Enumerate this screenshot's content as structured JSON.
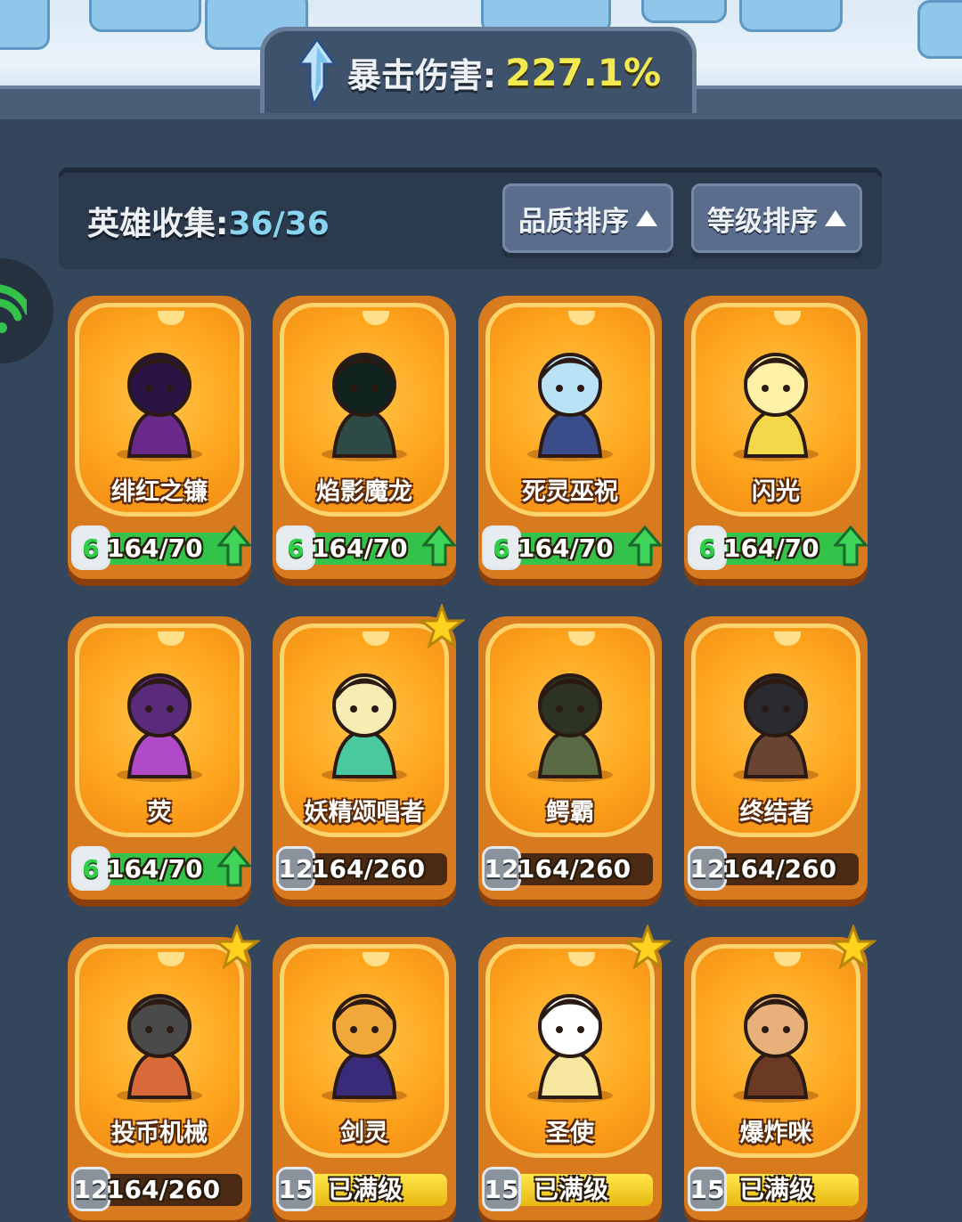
{
  "crit": {
    "label": "暴击伤害:",
    "value": "227.1%"
  },
  "collection": {
    "label": "英雄收集:",
    "count": "36/36"
  },
  "sort": {
    "quality": "品质排序",
    "level": "等级排序"
  },
  "colors": {
    "accent_gold": "#f3ea52",
    "progress_green": "#33c24a",
    "card_orange": "#ffa61e"
  },
  "heroes": [
    {
      "name": "绯红之镰",
      "level": "6",
      "progress": "164/70",
      "upgradable": true,
      "starred": false
    },
    {
      "name": "焰影魔龙",
      "level": "6",
      "progress": "164/70",
      "upgradable": true,
      "starred": false
    },
    {
      "name": "死灵巫祝",
      "level": "6",
      "progress": "164/70",
      "upgradable": true,
      "starred": false
    },
    {
      "name": "闪光",
      "level": "6",
      "progress": "164/70",
      "upgradable": true,
      "starred": false
    },
    {
      "name": "荧",
      "level": "6",
      "progress": "164/70",
      "upgradable": true,
      "starred": false
    },
    {
      "name": "妖精颂唱者",
      "level": "12",
      "progress": "164/260",
      "upgradable": false,
      "starred": true
    },
    {
      "name": "鳄霸",
      "level": "12",
      "progress": "164/260",
      "upgradable": false,
      "starred": false
    },
    {
      "name": "终结者",
      "level": "12",
      "progress": "164/260",
      "upgradable": false,
      "starred": false
    },
    {
      "name": "投币机械",
      "level": "12",
      "progress": "164/260",
      "upgradable": false,
      "starred": true
    },
    {
      "name": "剑灵",
      "level": "15",
      "progress": "已满级",
      "upgradable": false,
      "starred": false
    },
    {
      "name": "圣使",
      "level": "15",
      "progress": "已满级",
      "upgradable": false,
      "starred": true
    },
    {
      "name": "爆炸咪",
      "level": "15",
      "progress": "已满级",
      "upgradable": false,
      "starred": true
    }
  ]
}
